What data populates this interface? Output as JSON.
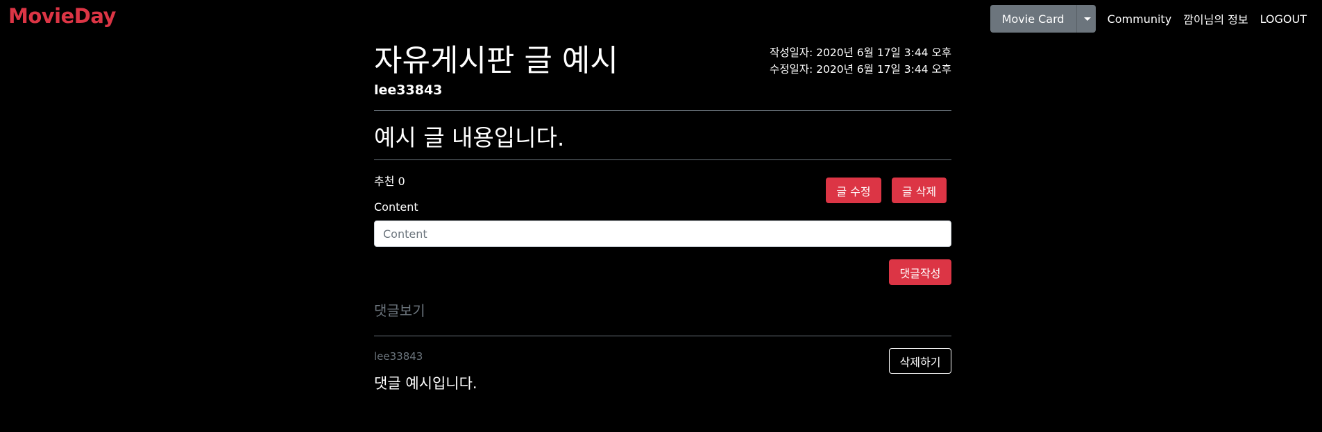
{
  "nav": {
    "brand": "MovieDay",
    "dropdown_label": "Movie Card",
    "links": [
      "Community",
      "깜이님의 정보",
      "LOGOUT"
    ]
  },
  "post": {
    "title": "자유게시판 글 예시",
    "author": "lee33843",
    "created": "작성일자: 2020년 6월 17일 3:44 오후",
    "modified": "수정일자: 2020년 6월 17일 3:44 오후",
    "content": "예시 글 내용입니다.",
    "recommend_label": "추천",
    "recommend_count": "0",
    "edit_label": "글 수정",
    "delete_label": "글 삭제"
  },
  "comment_form": {
    "label": "Content",
    "placeholder": "Content",
    "value": "",
    "submit_label": "댓글작성"
  },
  "comments": {
    "heading": "댓글보기",
    "items": [
      {
        "author": "lee33843",
        "text": "댓글 예시입니다.",
        "delete_label": "삭제하기"
      }
    ]
  },
  "colors": {
    "brand": "#dc3545",
    "secondary": "#6c757d",
    "background": "#000000"
  }
}
